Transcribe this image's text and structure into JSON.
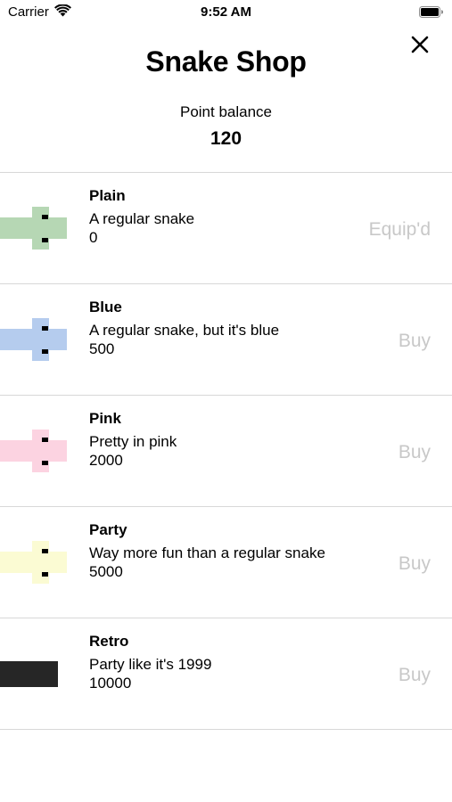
{
  "status_bar": {
    "carrier": "Carrier",
    "time": "9:52 AM"
  },
  "header": {
    "title": "Snake Shop",
    "balance_label": "Point balance",
    "balance_value": "120"
  },
  "colors": {
    "separator": "#d8d8d8",
    "action_disabled": "#c8c8c8"
  },
  "skins": [
    {
      "name": "Plain",
      "description": "A regular snake",
      "price": "0",
      "action": "Equip'd",
      "color": "#b6d7b4",
      "style": "standard"
    },
    {
      "name": "Blue",
      "description": "A regular snake, but it's blue",
      "price": "500",
      "action": "Buy",
      "color": "#b5ccee",
      "style": "standard"
    },
    {
      "name": "Pink",
      "description": "Pretty in pink",
      "price": "2000",
      "action": "Buy",
      "color": "#fcd3e1",
      "style": "standard"
    },
    {
      "name": "Party",
      "description": "Way more fun than a regular snake",
      "price": "5000",
      "action": "Buy",
      "color": "#fbfbd3",
      "style": "standard"
    },
    {
      "name": "Retro",
      "description": "Party like it's 1999",
      "price": "10000",
      "action": "Buy",
      "color": "#262626",
      "style": "retro"
    }
  ]
}
